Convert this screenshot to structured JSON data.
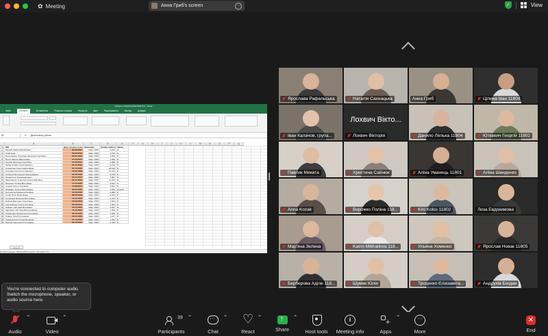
{
  "topbar": {
    "app_title": "Meeting",
    "share_label": "Анна Гриб's screen",
    "view_label": "View"
  },
  "toast": {
    "message": "You're connected to computer audio. Switch the microphone, speaker, or audio source here."
  },
  "spreadsheet": {
    "title": "Журнал співробітників 2025.xlsx - Excel",
    "tabs": [
      "Файл",
      "Основне",
      "Вставлення",
      "Розмітка сторінки",
      "Формули",
      "Дані",
      "Рецензування",
      "Вигляд",
      "Довідка"
    ],
    "name_box": "B2",
    "formula": "Дата початку роботи",
    "col_letters": [
      "A",
      "B",
      "C",
      "D",
      "E",
      "F",
      "G",
      "H",
      "I",
      "J",
      "K",
      "L",
      "M",
      "N",
      "O",
      "P",
      "Q"
    ],
    "headers": [
      "ПІБ",
      "Дата початку роботи",
      "Календар",
      "Термін роботи",
      "Зміна"
    ],
    "rows": [
      {
        "n": "2",
        "name": "Борзий Гамма Михайлівна",
        "date": "08.08.2021",
        "cal": "Март 2025",
        "term": "3,640",
        "shift": "Б"
      },
      {
        "n": "3",
        "name": "Грай Анна",
        "date": "09.08.2023",
        "cal": "Март 2025",
        "term": "3,700",
        "shift": "Б"
      },
      {
        "n": "4",
        "name": "Вольчанівич (Горіліне) Катерина Сергіївна",
        "date": "20.01.2023",
        "cal": "Март 2025",
        "term": "3,000",
        "shift": "Б"
      },
      {
        "n": "5",
        "name": "Булат Лариса Васильївна",
        "date": "27.05.2021",
        "cal": "Март 2025",
        "term": "4,009",
        "shift": "Б"
      },
      {
        "n": "6",
        "name": "Коляни Катерина Сергіївна",
        "date": "14.03.2014",
        "cal": "Март 2025",
        "term": "1,080",
        "shift": "Б"
      },
      {
        "n": "7",
        "name": "Зубар Роман Станіславович",
        "date": "01.11.2010",
        "cal": "Март 2025",
        "term": "5,210",
        "shift": "Б"
      },
      {
        "n": "8",
        "name": "Алпевська Ольга Анатоліївна",
        "date": "01.10.2000",
        "cal": "Март 2025",
        "term": "24,610",
        "shift": "Б"
      },
      {
        "n": "9",
        "name": "Коляцінь Костянтин Іванович",
        "date": "13.03.1998",
        "cal": "Март 2025",
        "term": "27,010",
        "shift": "Б"
      },
      {
        "n": "10",
        "name": "Грибінок Володимир Миколайович",
        "date": "02.06.2016",
        "cal": "Март 2025",
        "term": "8,760",
        "shift": "Б"
      },
      {
        "n": "11",
        "name": "Гринов Ігор Олександрович",
        "date": "01.07.2017",
        "cal": "Март 2025",
        "term": "7,867",
        "shift": "Б"
      },
      {
        "n": "12",
        "name": "Верхоменко Агрипина Олега Павлівна",
        "date": "01.11.2013",
        "cal": "Март 2025",
        "term": "11,310",
        "shift": "Б"
      },
      {
        "n": "13",
        "name": "Дешенко Тетяна Вікторівна",
        "date": "17.04.2020",
        "cal": "Март 2025",
        "term": "4,921",
        "shift": "Б"
      },
      {
        "n": "14",
        "name": "Сорока Ольга Сергіївна",
        "date": "19.09.2011",
        "cal": "Март 2025",
        "term": "3,810",
        "shift": "Б"
      },
      {
        "n": "15",
        "name": "Ясміевич Олена Миколаївна",
        "date": "06.03.2022",
        "cal": "Март 2025",
        "term": "3,000",
        "shift": "Нічний"
      },
      {
        "n": "16",
        "name": "Нестерука Людмила Юріївна",
        "date": "18.09.2018",
        "cal": "Март 2025",
        "term": "6,080",
        "shift": "Б"
      },
      {
        "n": "17",
        "name": "Гонар Юлія Миколаївна",
        "date": "28.05.2018",
        "cal": "Март 2025",
        "term": "6,810",
        "shift": "Б"
      },
      {
        "n": "18",
        "name": "Горинська Вероніка Вікторівна",
        "date": "10.11.2013",
        "cal": "Март 2025",
        "term": "1,110",
        "shift": "Б"
      },
      {
        "n": "19",
        "name": "Бойник Виктория Олексіївна",
        "date": "16.03.2023",
        "cal": "Март 2025",
        "term": "1,810",
        "shift": "Б"
      },
      {
        "n": "20",
        "name": "Анечковська Ольга Сергіївна",
        "date": "22.09.2024",
        "cal": "Март 2025",
        "term": "1,000",
        "shift": "Б"
      },
      {
        "n": "21",
        "name": "Жовнич Світлана Віталіївна",
        "date": "16.04.2022",
        "cal": "Март 2025",
        "term": "3,027",
        "shift": "Б"
      },
      {
        "n": "22",
        "name": "Карпенко Світлана Вячеславівна",
        "date": "11.11.2022",
        "cal": "Март 2025",
        "term": "2,300",
        "shift": "Б"
      },
      {
        "n": "23",
        "name": "Корвинова Наталія Костянтинівна",
        "date": "06.03.2022",
        "cal": "Март 2025",
        "term": "3,000",
        "shift": "Б"
      },
      {
        "n": "24",
        "name": "Пиврат Лілія Русланівна",
        "date": "16.01.2024",
        "cal": "Март 2025",
        "term": "1,167",
        "shift": "Б"
      },
      {
        "n": "25",
        "name": "Ковинна Юлія Олександрівна",
        "date": "01.12.2023",
        "cal": "Март 2025",
        "term": "1,250",
        "shift": "Б"
      },
      {
        "n": "26",
        "name": "Бурлий Анастасія Русланівна",
        "date": "04.10.2022",
        "cal": "Март 2025",
        "term": "2,420",
        "shift": "Б"
      }
    ],
    "sheet_tab": "Аркуш1",
    "status": "Готово      Середнє: 09/12/2019     Кількість: 26     Сума: 17/..."
  },
  "participants": [
    {
      "name": "Ярослава Рафальська",
      "muted": true,
      "active": false,
      "bg": "#8a7f74",
      "skin": "#d9b39a",
      "shirt": "#3b3b3b"
    },
    {
      "name": "Наталія Сахнацька",
      "muted": true,
      "active": false,
      "bg": "#b9b3ad",
      "skin": "#e0bfa5",
      "shirt": "#6d5e52"
    },
    {
      "name": "Анна Гриб",
      "muted": false,
      "active": true,
      "bg": "#9a9185",
      "skin": "#d7b092",
      "shirt": "#3a3632"
    },
    {
      "name": "Цілина Іван 11804",
      "muted": true,
      "active": false,
      "bg": "#2f2f2f",
      "skin": "#c99d82",
      "shirt": "#d9d9d9"
    },
    {
      "name": "Іван Калачов, група...",
      "muted": true,
      "active": false,
      "bg": "#7a736a",
      "skin": "#e2c3a9",
      "shirt": "#4a4a4a"
    },
    {
      "name": "Лохвич Вікторія",
      "muted": true,
      "active": false,
      "bg": "#2a2a2a",
      "skin": "",
      "shirt": "",
      "placeholder": "Лохвич Вікто..."
    },
    {
      "name": "Данило Лялька 11804",
      "muted": true,
      "active": false,
      "bg": "#c8c1b8",
      "skin": "#d9b49b",
      "shirt": "#2f2f2f"
    },
    {
      "name": "Ютквеич Георгій 11802",
      "muted": true,
      "active": false,
      "bg": "#bfb7a8",
      "skin": "#dcb99f",
      "shirt": "#6e7a5a"
    },
    {
      "name": "Павлик  Микита",
      "muted": true,
      "active": false,
      "bg": "#d7d0c7",
      "skin": "#dfbda2",
      "shirt": "#3d3d3d"
    },
    {
      "name": "Христина Сайнюк",
      "muted": true,
      "active": false,
      "bg": "#cfc9c1",
      "skin": "#e3c2a7",
      "shirt": "#8a8078"
    },
    {
      "name": "Аліна Уманець 11801",
      "muted": true,
      "active": false,
      "bg": "#3a3633",
      "skin": "#d5b096",
      "shirt": "#1f1f1f"
    },
    {
      "name": "Аліна Швиденко",
      "muted": true,
      "active": false,
      "bg": "#c9c2b8",
      "skin": "#dfbfa5",
      "shirt": "#b8a79a"
    },
    {
      "name": "Anna Kozak",
      "muted": true,
      "active": false,
      "bg": "#b4aba1",
      "skin": "#d8b69c",
      "shirt": "#5a4e46"
    },
    {
      "name": "Ворожко Поліна 118...",
      "muted": true,
      "active": false,
      "bg": "#d6d1cb",
      "skin": "#e5c6ab",
      "shirt": "#2c2c2c"
    },
    {
      "name": "Kiril Kolos 11802",
      "muted": true,
      "active": false,
      "bg": "#cbc4bb",
      "skin": "#dbb99e",
      "shirt": "#4d5660"
    },
    {
      "name": "Лиза Евдокимова",
      "muted": false,
      "active": false,
      "bg": "#2a2a2a",
      "skin": "#d9b59a",
      "shirt": "#383838"
    },
    {
      "name": "Мар'яна Зелена",
      "muted": true,
      "active": false,
      "bg": "#a89b90",
      "skin": "#dcb89c",
      "shirt": "#6b5a66"
    },
    {
      "name": "Katrin Mikhailova 118...",
      "muted": true,
      "active": false,
      "bg": "#d4cec7",
      "skin": "#e0c0a6",
      "shirt": "#e8e8e8"
    },
    {
      "name": "Ульяна Хоменко",
      "muted": true,
      "active": false,
      "bg": "#cec7bd",
      "skin": "#e0bfa3",
      "shirt": "#c7b6a6"
    },
    {
      "name": "Ярослав Новак 11805",
      "muted": true,
      "active": false,
      "bg": "#3c3a38",
      "skin": "#d7b398",
      "shirt": "#2a2a2a"
    },
    {
      "name": "Берберова Аділе 118...",
      "muted": true,
      "active": false,
      "bg": "#b8b1a8",
      "skin": "#d8b497",
      "shirt": "#2f2f2f"
    },
    {
      "name": "Шумик Юлія",
      "muted": true,
      "active": false,
      "bg": "#d3cdc5",
      "skin": "#e1c1a6",
      "shirt": "#b3a597"
    },
    {
      "name": "Троценко Єлизавета...",
      "muted": true,
      "active": false,
      "bg": "#c6bfb6",
      "skin": "#dcb99d",
      "shirt": "#5d6b7a"
    },
    {
      "name": "Андрухів Богдан",
      "muted": true,
      "active": false,
      "bg": "#2d2d2d",
      "skin": "#d5b094",
      "shirt": "#d8d8d8"
    }
  ],
  "toolbar": {
    "audio": "Audio",
    "video": "Video",
    "participants": "Participants",
    "participants_count": "39",
    "chat": "Chat",
    "react": "React",
    "share": "Share",
    "host_tools": "Host tools",
    "meeting_info": "Meeting info",
    "apps": "Apps",
    "more": "More",
    "end": "End"
  }
}
